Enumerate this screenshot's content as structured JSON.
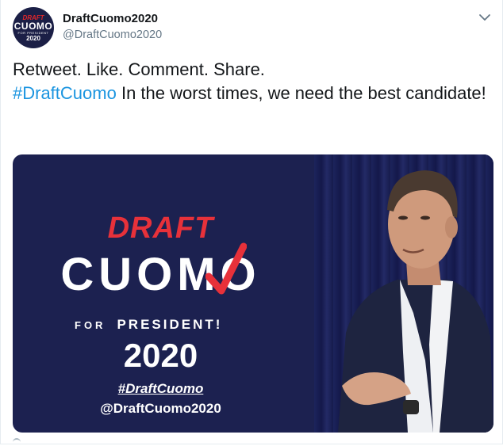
{
  "tweet": {
    "display_name": "DraftCuomo2020",
    "handle": "@DraftCuomo2020",
    "text_line1": "Retweet. Like. Comment. Share.",
    "hashtag": "#DraftCuomo",
    "text_rest": " In the worst times, we need the best candidate!"
  },
  "avatar": {
    "draft": "DRAFT",
    "name": "CUOMO",
    "for_president": "FOR PRESIDENT",
    "year": "2020"
  },
  "media": {
    "draft": "DRAFT",
    "name": "CUOMO",
    "for_word": "FOR",
    "president": "PRESIDENT!",
    "year": "2020",
    "hashtag": "#DraftCuomo",
    "handle": "@DraftCuomo2020"
  },
  "icons": {
    "menu": "chevron-down-icon",
    "check": "checkmark-icon"
  },
  "colors": {
    "link": "#1b95e0",
    "banner_bg": "#1c2150",
    "accent_red": "#e7313a"
  }
}
